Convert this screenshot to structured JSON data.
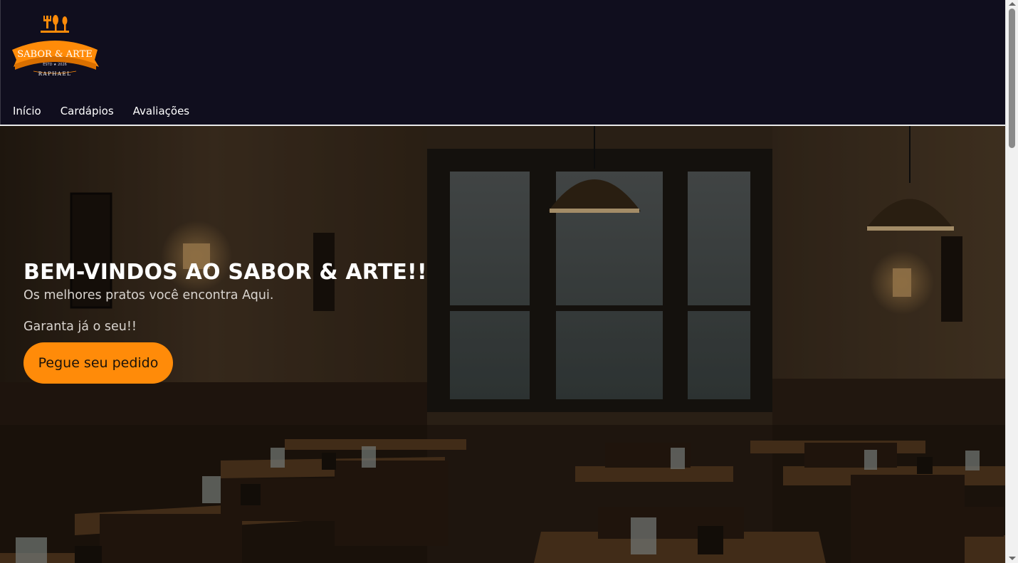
{
  "brand": {
    "logo_text": "SABOR & ARTE",
    "logo_est": "ESTD ★ 2026",
    "logo_name": "RAPHAEL",
    "accent": "#ff8b09"
  },
  "nav": {
    "items": [
      {
        "label": "Início"
      },
      {
        "label": "Cardápios"
      },
      {
        "label": "Avaliações"
      }
    ]
  },
  "hero": {
    "title": "BEM-VINDOS AO SABOR & ARTE!!",
    "subtitle": "Os melhores pratos você encontra Aqui.",
    "subtitle2": "Garanta já o seu!!",
    "cta_label": "Pegue seu pedido",
    "background": "dark restaurant interior with tables, windows and pendant lamps"
  },
  "icons": {
    "logo": "cutlery-logo-icon",
    "scroll_up": "scroll-up-arrow-icon",
    "scroll_down": "scroll-down-arrow-icon"
  }
}
